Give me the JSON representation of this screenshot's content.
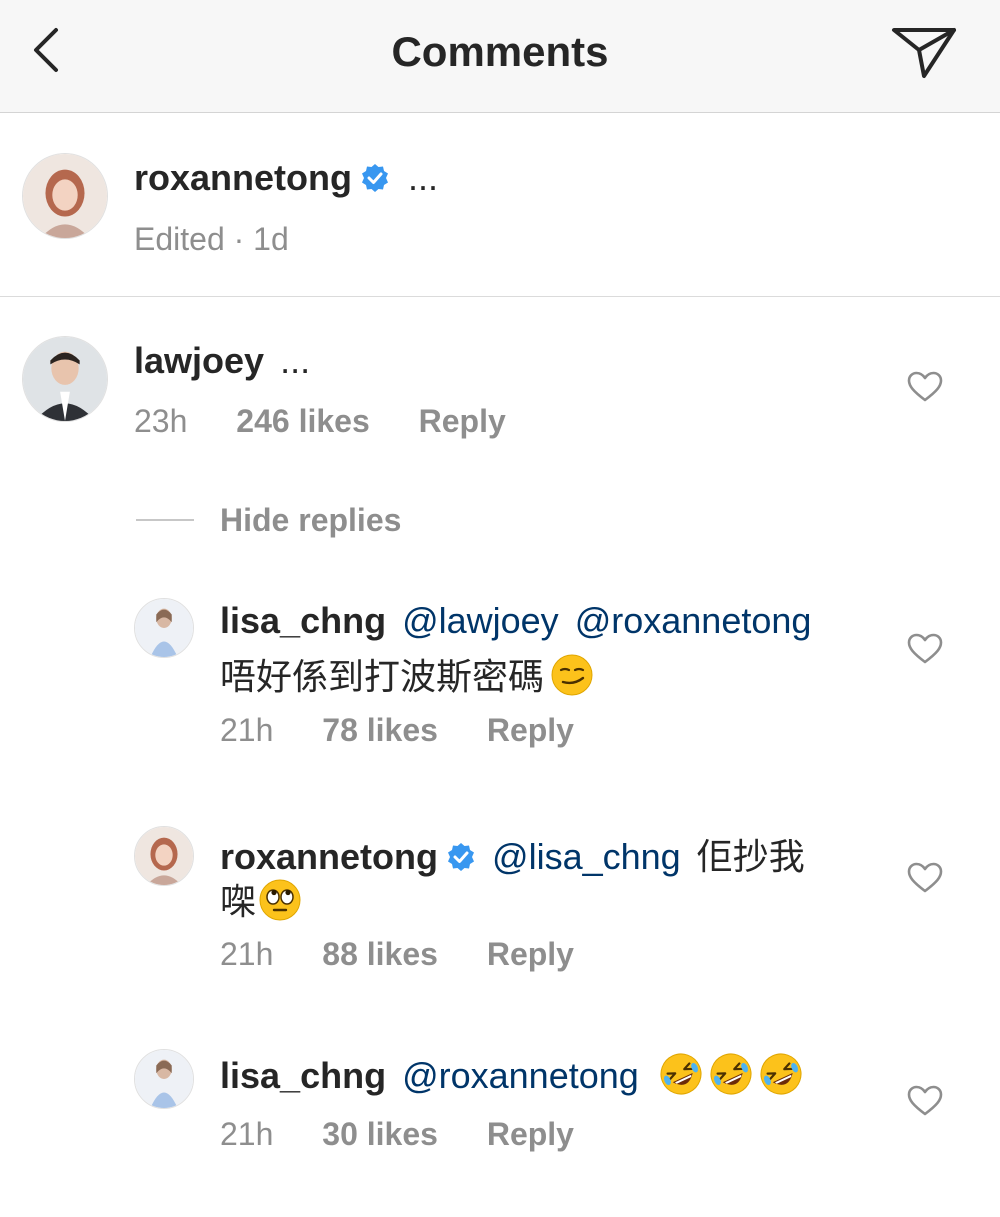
{
  "header": {
    "title": "Comments",
    "back_icon": "chevron-left-icon",
    "send_icon": "paper-plane-icon"
  },
  "caption": {
    "username": "roxannetong",
    "text": "...",
    "edited": "Edited",
    "separator": "·",
    "time": "1d"
  },
  "comment": {
    "username": "lawjoey",
    "text": "...",
    "time": "23h",
    "likes": "246 likes",
    "reply": "Reply"
  },
  "hide_replies": "Hide replies",
  "replies": [
    {
      "username": "lisa_chng",
      "mention1": "@lawjoey",
      "mention2": "@roxannetong",
      "text": "唔好係到打波斯密碼",
      "emoji": "smirking-face-emoji",
      "time": "21h",
      "likes": "78 likes",
      "reply": "Reply"
    },
    {
      "username": "roxannetong",
      "mention1": "@lisa_chng",
      "text_line1": "佢抄我",
      "text_line2": "㗎",
      "emoji": "rolling-eyes-emoji",
      "time": "21h",
      "likes": "88 likes",
      "reply": "Reply"
    },
    {
      "username": "lisa_chng",
      "mention1": "@roxannetong",
      "emoji": "rofl-emoji",
      "emoji_count": 3,
      "time": "21h",
      "likes": "30 likes",
      "reply": "Reply"
    }
  ],
  "colors": {
    "verified": "#3897f0",
    "mention": "#003569",
    "meta": "#8e8e8e",
    "header_bg": "#f7f7f7"
  }
}
